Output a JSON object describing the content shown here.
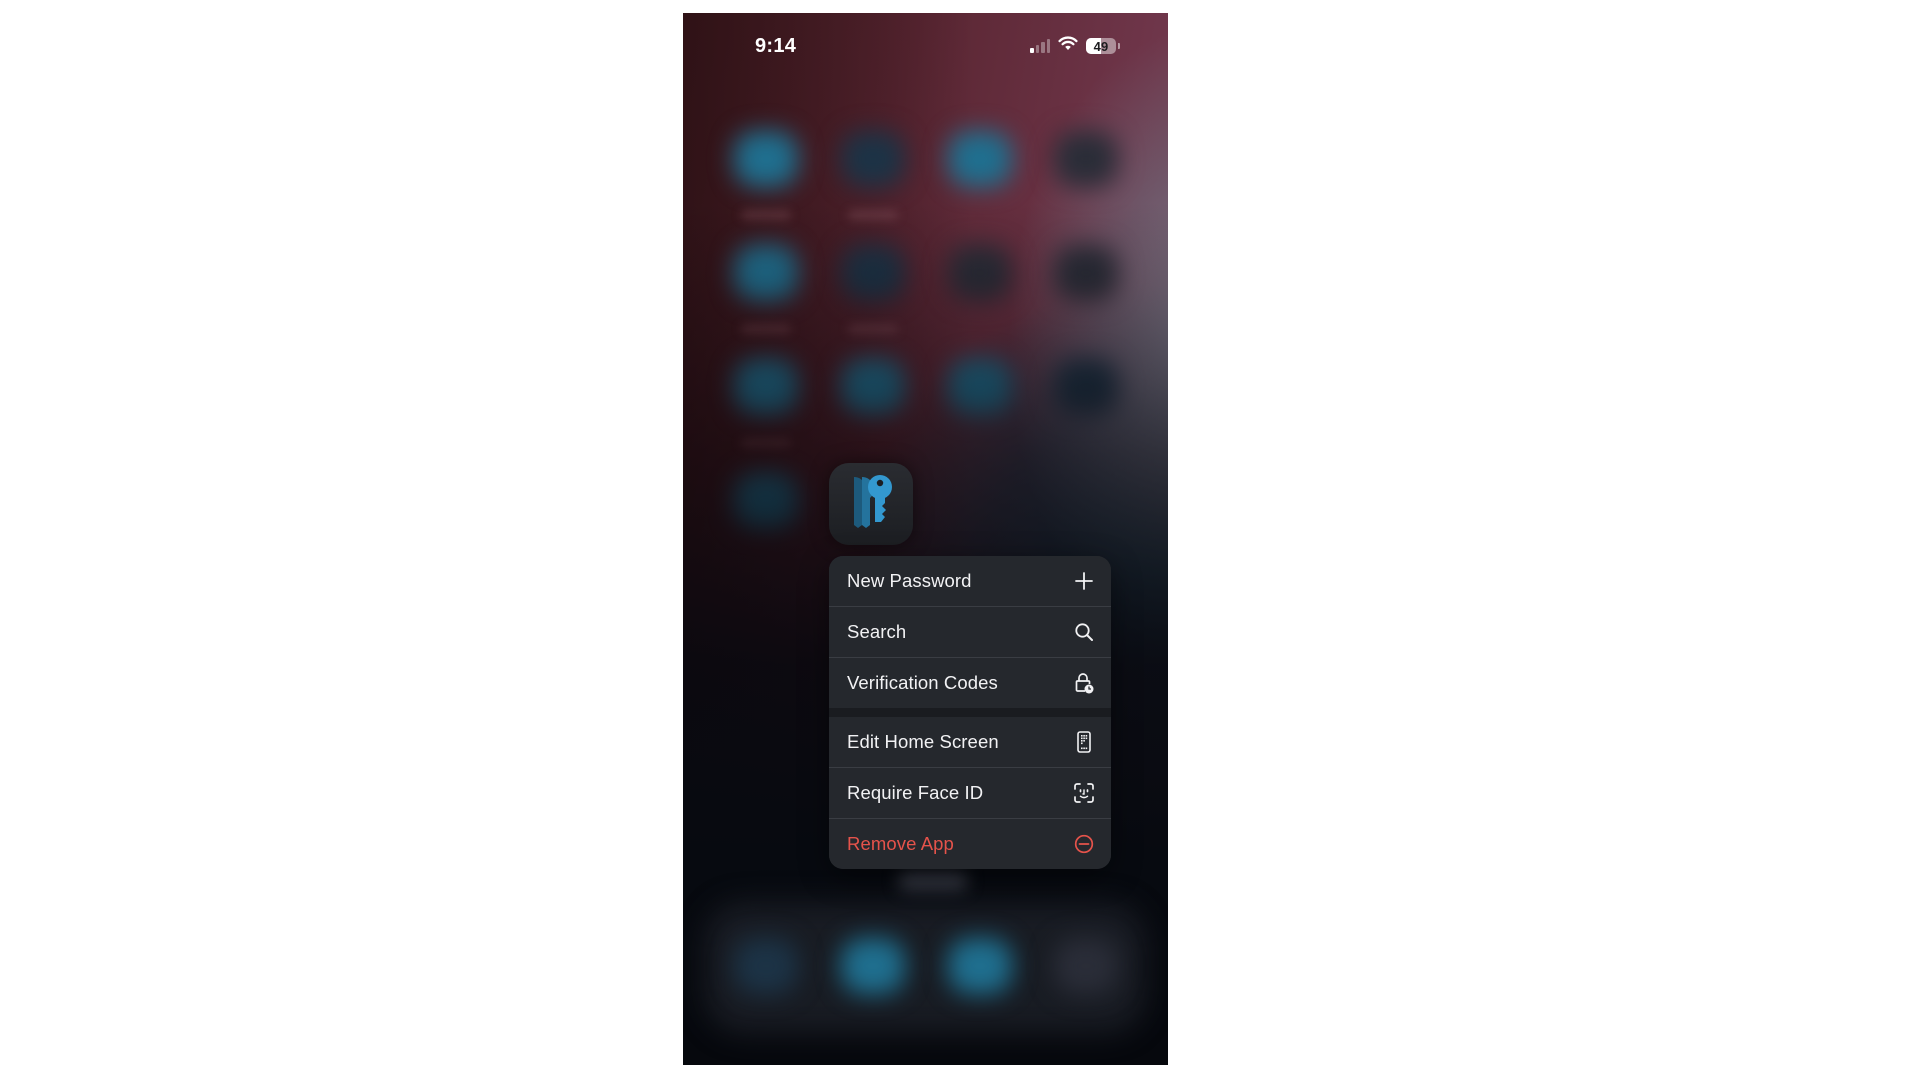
{
  "status_bar": {
    "time": "9:14",
    "signal_bars_active": 1,
    "signal_bars_total": 4,
    "wifi": "full",
    "battery_percent": 49,
    "battery_label": "49"
  },
  "app": {
    "name": "Passwords",
    "icon": "keys-icon",
    "accent_color": "#2f8fc4"
  },
  "context_menu": {
    "groups": [
      {
        "items": [
          {
            "label": "New Password",
            "icon": "plus-icon",
            "destructive": false
          },
          {
            "label": "Search",
            "icon": "search-icon",
            "destructive": false
          },
          {
            "label": "Verification Codes",
            "icon": "lock-clock-icon",
            "destructive": false
          }
        ]
      },
      {
        "items": [
          {
            "label": "Edit Home Screen",
            "icon": "phone-grid-icon",
            "destructive": false
          },
          {
            "label": "Require Face ID",
            "icon": "face-id-icon",
            "destructive": false
          },
          {
            "label": "Remove App",
            "icon": "minus-circle-icon",
            "destructive": true
          }
        ]
      }
    ]
  },
  "colors": {
    "menu_background": "#25282d",
    "menu_text": "#f2f2f4",
    "destructive": "#e5534b"
  }
}
